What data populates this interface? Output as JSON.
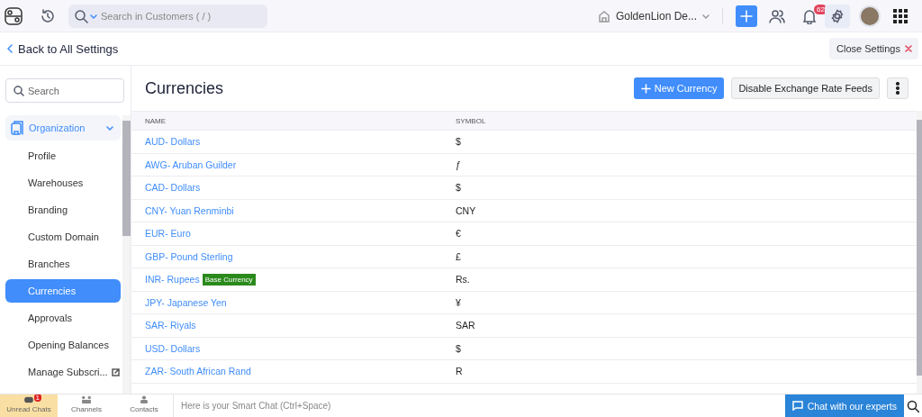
{
  "top_bar": {
    "search": {
      "placeholder": "Search in Customers ( / )"
    },
    "organization": "GoldenLion De...",
    "notifications": {
      "count": "62"
    }
  },
  "back_link": "Back to All Settings",
  "close_button": "Close Settings",
  "sidebar": {
    "search": {
      "placeholder": "Search"
    },
    "section": {
      "label": "Organization",
      "expanded": true
    },
    "items": [
      {
        "label": "Profile",
        "selected": false
      },
      {
        "label": "Warehouses",
        "selected": false
      },
      {
        "label": "Branding",
        "selected": false
      },
      {
        "label": "Custom Domain",
        "selected": false
      },
      {
        "label": "Branches",
        "selected": false
      },
      {
        "label": "Currencies",
        "selected": true
      },
      {
        "label": "Approvals",
        "selected": false
      },
      {
        "label": "Opening Balances",
        "selected": false
      },
      {
        "label": "Manage Subscri...",
        "selected": false,
        "external": true
      }
    ]
  },
  "page": {
    "title": "Currencies",
    "buttons": {
      "new": "New Currency",
      "disable": "Disable Exchange Rate Feeds"
    }
  },
  "table": {
    "columns": [
      "NAME",
      "SYMBOL"
    ],
    "rows": [
      {
        "name": "AUD- Dollars",
        "symbol": "$"
      },
      {
        "name": "AWG- Aruban Guilder",
        "symbol": "ƒ"
      },
      {
        "name": "CAD- Dollars",
        "symbol": "$"
      },
      {
        "name": "CNY- Yuan Renminbi",
        "symbol": "CNY"
      },
      {
        "name": "EUR- Euro",
        "symbol": "€"
      },
      {
        "name": "GBP- Pound Sterling",
        "symbol": "£"
      },
      {
        "name": "INR- Rupees",
        "badge": "Base Currency",
        "symbol": "Rs."
      },
      {
        "name": "JPY- Japanese Yen",
        "symbol": "¥"
      },
      {
        "name": "SAR- Riyals",
        "symbol": "SAR"
      },
      {
        "name": "USD- Dollars",
        "symbol": "$"
      },
      {
        "name": "ZAR- South African Rand",
        "symbol": "R"
      }
    ]
  },
  "bottom_bar": {
    "tabs": [
      {
        "label": "Unread Chats",
        "badge": "1",
        "selected": true
      },
      {
        "label": "Channels",
        "selected": false
      },
      {
        "label": "Contacts",
        "selected": false
      }
    ],
    "chat": {
      "placeholder": "Here is your Smart Chat (Ctrl+Space)"
    },
    "expert_button": "Chat with our experts"
  }
}
